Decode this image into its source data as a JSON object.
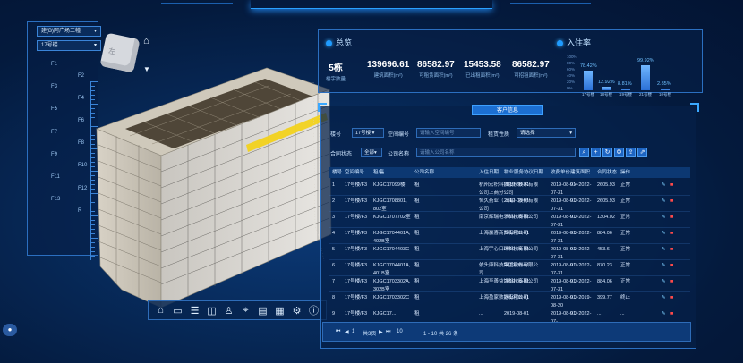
{
  "floor_selectors": {
    "building": "建(B)阿广场三幢",
    "floor": "17号楼"
  },
  "floor_labels": [
    "F1",
    "F2",
    "F3",
    "F4",
    "F5",
    "F6",
    "F7",
    "F8",
    "F9",
    "F10",
    "F11",
    "F12",
    "F13",
    "R"
  ],
  "cube_label": "左",
  "overview": {
    "title": "总览",
    "stats": [
      {
        "value": "5栋",
        "label": "楼宇数量"
      },
      {
        "value": "139696.61",
        "label": "建筑面积(m²)"
      },
      {
        "value": "86582.97",
        "label": "可租赁面积(m²)"
      },
      {
        "value": "15453.58",
        "label": "已出租面积(m²)"
      },
      {
        "value": "86582.97",
        "label": "可招租面积(m²)"
      }
    ]
  },
  "occupancy": {
    "title": "入住率",
    "y_ticks": [
      "100%",
      "80%",
      "60%",
      "40%",
      "20%",
      "0%"
    ],
    "bars": [
      {
        "label": "17号楼",
        "pct": "78.42%",
        "value": 78.42
      },
      {
        "label": "18号楼",
        "pct": "12.92%",
        "value": 12.92
      },
      {
        "label": "19号楼",
        "pct": "8.81%",
        "value": 8.81
      },
      {
        "label": "21号楼",
        "pct": "99.92%",
        "value": 99.92
      },
      {
        "label": "10号楼",
        "pct": "2.85%",
        "value": 2.85
      }
    ]
  },
  "table_panel": {
    "tab_label": "客户信息",
    "filters": {
      "building_label": "楼号",
      "building_value": "17号楼",
      "space_label": "空间编号",
      "space_placeholder": "请输入空间编号",
      "rent_label": "租赁性质",
      "rent_value": "请选择",
      "status_label": "合同状态",
      "status_value": "全部",
      "company_label": "公司名称",
      "company_placeholder": "请输入公司名称"
    },
    "toolbar_icons": [
      "search-icon",
      "add-icon",
      "refresh-icon",
      "settings-icon",
      "export-icon",
      "share-icon"
    ],
    "columns": [
      "楼号",
      "空间编号",
      "租/售",
      "公司名称",
      "入住日期",
      "物业服务协议日期",
      "收费单价",
      "建筑面积",
      "合同状态",
      "操作"
    ],
    "rows": [
      {
        "n": "1",
        "b": "17号楼/F3",
        "s": "KJGC17099楼",
        "t": "租",
        "c": "杭州宏积科技股份技术有限公司上商分公司",
        "d": "2019-08-01",
        "p": "2019-08-01~2022-07-31",
        "u": "9.4",
        "a": "2605.93",
        "st": "正常"
      },
      {
        "n": "2",
        "b": "17号楼/F3",
        "s": "KJGC1708801, 802室",
        "t": "租",
        "c": "恒久药业（上海）股份有限公司",
        "d": "2019-08-01",
        "p": "2019-08-01~2022-07-31",
        "u": "9.3",
        "a": "2605.93",
        "st": "正常"
      },
      {
        "n": "3",
        "b": "17号楼/F3",
        "s": "KJGC1707702室",
        "t": "租",
        "c": "南京辉瑞电子科技有限公司",
        "d": "2019-08-01",
        "p": "2019-08-01~2022-07-31",
        "u": "9.3",
        "a": "1304.02",
        "st": "正常"
      },
      {
        "n": "4",
        "b": "17号楼/F3",
        "s": "KJGC1704401A, 402B室",
        "t": "租",
        "c": "上海赢喜商贸有限公司",
        "d": "2019-08-01",
        "p": "2019-08-01~2022-07-31",
        "u": "9.3",
        "a": "884.06",
        "st": "正常"
      },
      {
        "n": "5",
        "b": "17号楼/F3",
        "s": "KJGC1704403C",
        "t": "租",
        "c": "上海宇心口环科技有限公司",
        "d": "2019-08-01",
        "p": "2019-08-01~2022-07-31",
        "u": "9.3",
        "a": "453.6",
        "st": "正常"
      },
      {
        "n": "6",
        "b": "17号楼/F3",
        "s": "KJGC1704401A, 401B室",
        "t": "租",
        "c": "依头康科技集团股份有限公司",
        "d": "2019-08-01",
        "p": "2019-08-01~2022-07-31",
        "u": "9.3",
        "a": "870.23",
        "st": "正常"
      },
      {
        "n": "7",
        "b": "17号楼/F3",
        "s": "KJGC1703302A, 302B室",
        "t": "租",
        "c": "上海至善益世科技有限公司",
        "d": "2019-08-01",
        "p": "2019-08-01~2022-07-31",
        "u": "9.3",
        "a": "884.06",
        "st": "正常"
      },
      {
        "n": "8",
        "b": "17号楼/F3",
        "s": "KJGC1703302C",
        "t": "租",
        "c": "上海盈家数据有限公司",
        "d": "2019-08-01",
        "p": "2019-08-01~2019-08-20",
        "u": "9.3",
        "a": "399.77",
        "st": "终止"
      },
      {
        "n": "9",
        "b": "17号楼/F3",
        "s": "KJGC17...",
        "t": "租",
        "c": "...",
        "d": "2019-08-01",
        "p": "2019-08-01~2022-07-...",
        "u": "9.3",
        "a": "...",
        "st": "..."
      }
    ],
    "pager": {
      "page": "1",
      "page_of": "共3页",
      "page_size": "10",
      "range": "1 - 10 共 26 条"
    }
  },
  "bottom_toolbar_icons": [
    "home-icon",
    "area-icon",
    "floor-icon",
    "measure-icon",
    "person-icon",
    "pin-icon",
    "list-icon",
    "table-icon",
    "gear-icon",
    "info-icon"
  ]
}
